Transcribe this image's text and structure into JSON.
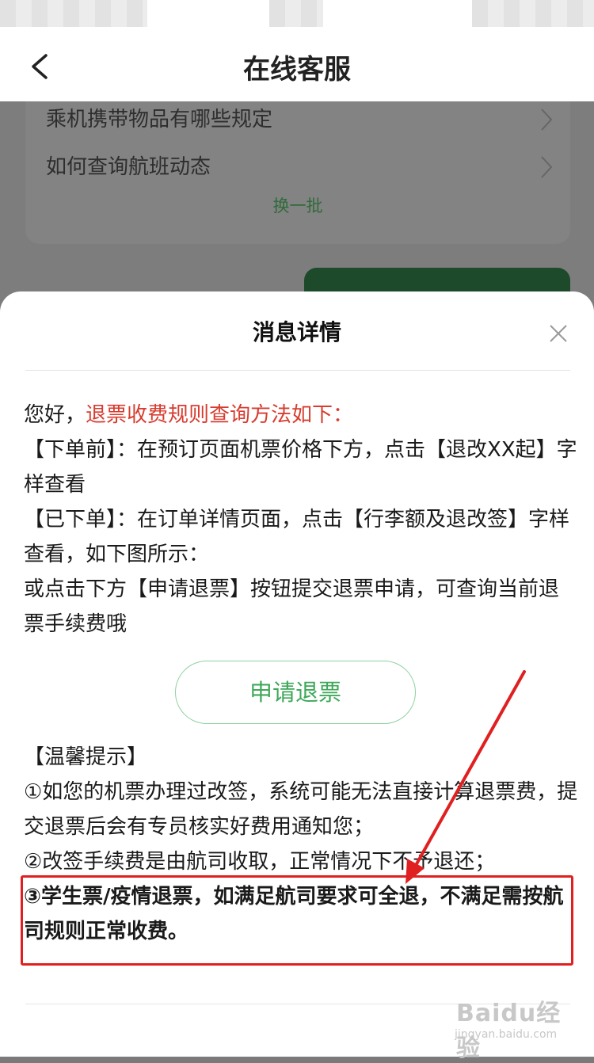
{
  "header": {
    "title": "在线客服"
  },
  "faq": {
    "items": [
      {
        "label": "乘机携带物品有哪些规定"
      },
      {
        "label": "如何查询航班动态"
      }
    ],
    "refresh_label": "换一批"
  },
  "sheet": {
    "title": "消息详情",
    "greeting": "您好，",
    "greeting_highlight": "退票收费规则查询方法如下：",
    "before_order_label": "【下单前】：",
    "before_order_text": "在预订页面机票价格下方，点击【退改XX起】字样查看",
    "after_order_label": "【已下单】：",
    "after_order_text": "在订单详情页面，点击【行李额及退改签】字样查看，如下图所示：",
    "alt_text": "或点击下方【申请退票】按钮提交退票申请，可查询当前退票手续费哦",
    "refund_button": "申请退票",
    "tips_title": "【温馨提示】",
    "tips": [
      "①如您的机票办理过改签，系统可能无法直接计算退票费，提交退票后会有专员核实好费用通知您；",
      "②改签手续费是由航司收取，正常情况下不予退还；",
      "③学生票/疫情退票，如满足航司要求可全退，不满足需按航司规则正常收费。"
    ]
  },
  "watermark": {
    "brand": "Baidu经验",
    "url": "jingyan.baidu.com"
  },
  "colors": {
    "accent_red": "#d73c2f",
    "accent_green": "#3fa85a",
    "annotation_red": "#e02020"
  }
}
